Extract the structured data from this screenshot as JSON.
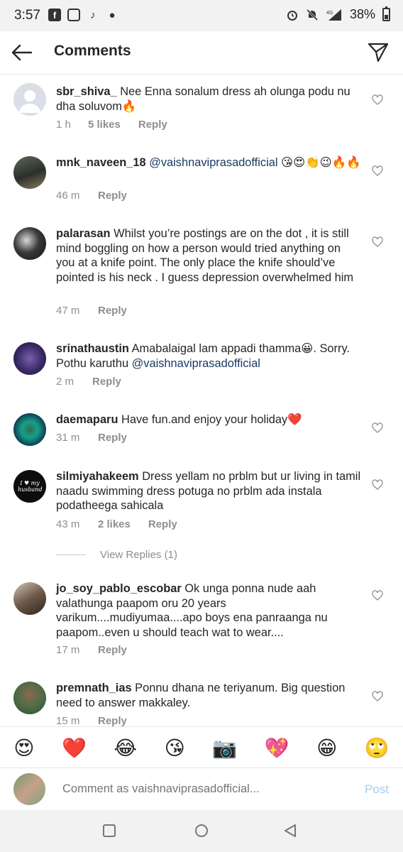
{
  "status_bar": {
    "time": "3:57",
    "app_icons": [
      "facebook-icon",
      "instagram-icon",
      "tiktok-icon",
      "reddit-icon"
    ],
    "network": "4G",
    "battery": "38%"
  },
  "header": {
    "title": "Comments"
  },
  "comments": [
    {
      "username": "sbr_shiva_",
      "text": "Nee Enna sonalum dress ah olunga podu nu dha soluvom🔥",
      "time": "1 h",
      "likes": "5 likes",
      "reply": "Reply"
    },
    {
      "username": "mnk_naveen_18",
      "mention": "@vaishnaviprasadofficial",
      "text": "😘😍👏😉🔥🔥",
      "time": "46 m",
      "reply": "Reply"
    },
    {
      "username": "palarasan",
      "text": "Whilst you’re postings are on the dot , it is still mind boggling on how a person would tried anything on you at a knife point. The only place the knife should’ve pointed is his neck . I guess depression overwhelmed him",
      "time": "47 m",
      "reply": "Reply"
    },
    {
      "username": "srinathaustin",
      "text": "Amabalaigal lam appadi thamma😀. Sorry. Pothu karuthu",
      "mention": "@vaishnaviprasadofficial",
      "time": "2 m",
      "reply": "Reply"
    },
    {
      "username": "daemaparu",
      "text": "Have fun.and enjoy your holiday❤️",
      "time": "31 m",
      "reply": "Reply"
    },
    {
      "username": "silmiyahakeem",
      "text": "Dress yellam no prblm but ur living in tamil naadu swimming dress potuga no prblm ada instala podatheega sahicala",
      "time": "43 m",
      "likes": "2 likes",
      "reply": "Reply",
      "view_replies": "View Replies (1)"
    },
    {
      "username": "jo_soy_pablo_escobar",
      "text": "Ok unga ponna nude aah valathunga paapom oru 20 years varikum....mudiyumaa....apo boys ena panraanga nu paapom..even u should teach wat to wear....",
      "time": "17 m",
      "reply": "Reply"
    },
    {
      "username": "premnath_ias",
      "text": "Ponnu dhana ne teriyanum. Big question need to answer makkaley.",
      "time": "15 m",
      "reply": "Reply"
    }
  ],
  "avatar_texts": {
    "silmiyahakeem": "I ♥ my husband"
  },
  "emoji_bar": [
    "😍",
    "❤️",
    "😂",
    "😘",
    "📷",
    "💖",
    "😁",
    "🙄"
  ],
  "composer": {
    "placeholder": "Comment as vaishnaviprasadofficial...",
    "post_label": "Post"
  },
  "colors": {
    "mention": "#1c3a63",
    "meta_gray": "#8e8e8e",
    "post_disabled": "#a6cdf4"
  }
}
